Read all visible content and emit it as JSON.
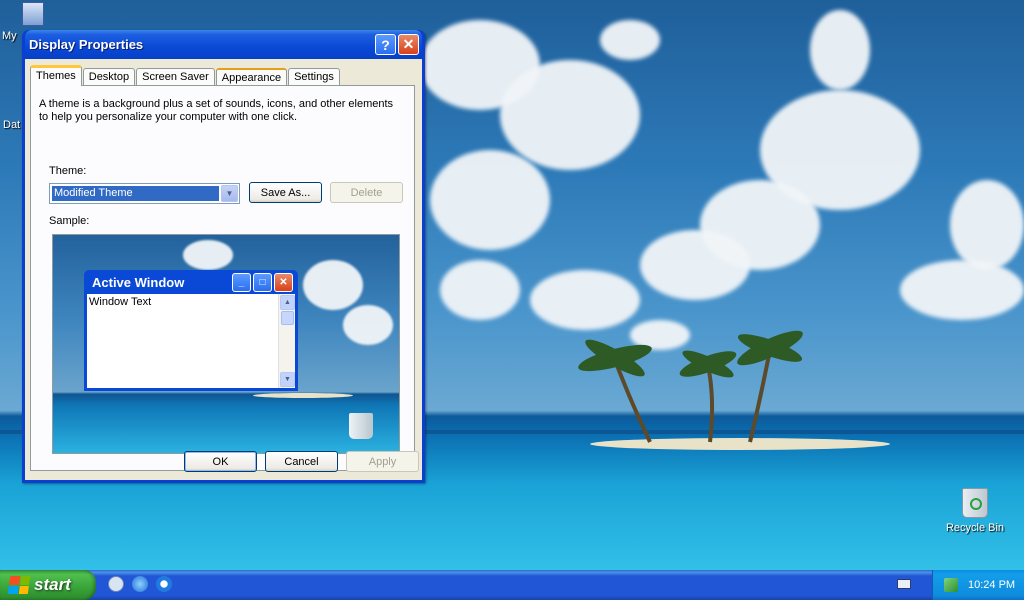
{
  "window": {
    "title": "Display Properties",
    "help_btn": "?",
    "close_btn": "✕"
  },
  "tabs": [
    {
      "label": "Themes"
    },
    {
      "label": "Desktop"
    },
    {
      "label": "Screen Saver"
    },
    {
      "label": "Appearance"
    },
    {
      "label": "Settings"
    }
  ],
  "themes_panel": {
    "description": "A theme is a background plus a set of sounds, icons, and other elements to help you personalize your computer with one click.",
    "theme_label": "Theme:",
    "theme_value": "Modified Theme",
    "save_as": "Save As...",
    "delete": "Delete",
    "sample_label": "Sample:"
  },
  "sample": {
    "window_title": "Active Window",
    "window_text": "Window Text"
  },
  "dialog_buttons": {
    "ok": "OK",
    "cancel": "Cancel",
    "apply": "Apply"
  },
  "desktop": {
    "icons": [
      {
        "label": "My"
      },
      {
        "label": "Dat"
      },
      {
        "label": "Recycle Bin"
      }
    ]
  },
  "taskbar": {
    "start_label": "start",
    "clock": "10:24 PM"
  },
  "colors": {
    "title_blue": "#0a48d6",
    "start_green": "#39a339",
    "tray_blue": "#0f8bde",
    "selection": "#316ac5"
  }
}
